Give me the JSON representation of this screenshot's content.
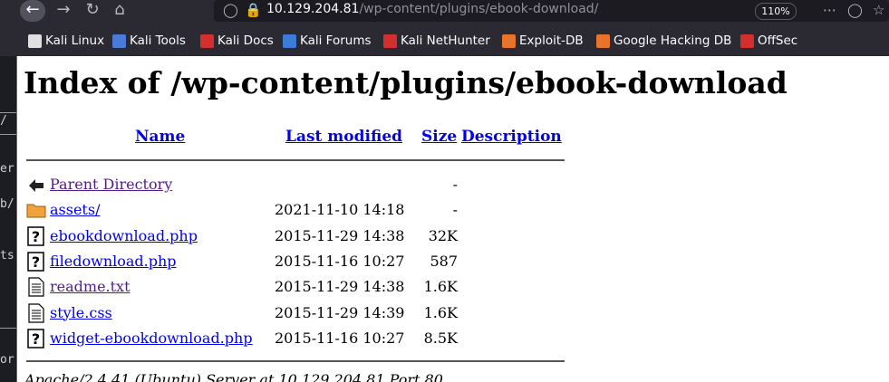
{
  "browser": {
    "url_host": "10.129.204.81",
    "url_path": "/wp-content/plugins/ebook-download/",
    "zoom": "110%",
    "bookmarks": [
      {
        "label": "Kali Linux",
        "icon": "kali-dragon-icon",
        "color": "#e0e0e0"
      },
      {
        "label": "Kali Tools",
        "icon": "kali-tools-icon",
        "color": "#4a7bd8"
      },
      {
        "label": "Kali Docs",
        "icon": "kali-docs-icon",
        "color": "#d32f2f"
      },
      {
        "label": "Kali Forums",
        "icon": "kali-forums-icon",
        "color": "#3d7bd9"
      },
      {
        "label": "Kali NetHunter",
        "icon": "nethunter-icon",
        "color": "#d32f2f"
      },
      {
        "label": "Exploit-DB",
        "icon": "exploitdb-icon",
        "color": "#e8742c"
      },
      {
        "label": "Google Hacking DB",
        "icon": "ghdb-icon",
        "color": "#e8742c"
      },
      {
        "label": "OffSec",
        "icon": "offsec-icon",
        "color": "#d32f2f"
      }
    ]
  },
  "terminal": {
    "fragments": [
      "/",
      "er",
      "b/",
      "ts",
      "or"
    ]
  },
  "page": {
    "title": "Index of /wp-content/plugins/ebook-download",
    "headers": {
      "name": "Name",
      "modified": "Last modified",
      "size": "Size",
      "description": "Description"
    },
    "rows": [
      {
        "name": "Parent Directory",
        "modified": "",
        "size": "-",
        "icon": "back-arrow-icon",
        "visited": true
      },
      {
        "name": "assets/",
        "modified": "2021-11-10 14:18",
        "size": "-",
        "icon": "folder-icon",
        "visited": false
      },
      {
        "name": "ebookdownload.php",
        "modified": "2015-11-29 14:38",
        "size": "32K",
        "icon": "unknown-file-icon",
        "visited": false
      },
      {
        "name": "filedownload.php",
        "modified": "2015-11-16 10:27",
        "size": "587",
        "icon": "unknown-file-icon",
        "visited": false
      },
      {
        "name": "readme.txt",
        "modified": "2015-11-29 14:38",
        "size": "1.6K",
        "icon": "text-file-icon",
        "visited": true
      },
      {
        "name": "style.css",
        "modified": "2015-11-29 14:39",
        "size": "1.6K",
        "icon": "text-file-icon",
        "visited": false
      },
      {
        "name": "widget-ebookdownload.php",
        "modified": "2015-11-16 10:27",
        "size": "8.5K",
        "icon": "unknown-file-icon",
        "visited": false
      }
    ],
    "footer": "Apache/2.4.41 (Ubuntu) Server at 10.129.204.81 Port 80"
  }
}
